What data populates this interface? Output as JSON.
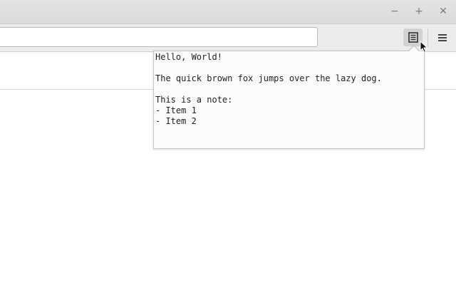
{
  "window": {
    "minimize_icon": "minimize-icon",
    "maximize_icon": "maximize-icon",
    "close_icon": "close-icon",
    "minimize_glyph": "−",
    "maximize_glyph": "+",
    "close_glyph": "✕"
  },
  "toolbar": {
    "url_value": "",
    "url_placeholder": "",
    "notes_button_icon": "notes-icon",
    "menu_icon": "hamburger-menu-icon"
  },
  "popup": {
    "note_content": "Hello, World!\n\nThe quick brown fox jumps over the lazy dog.\n\nThis is a note:\n- Item 1\n- Item 2"
  },
  "colors": {
    "titlebar": "#dadada",
    "toolbar": "#ececec",
    "active_button": "#d2d2d2",
    "popup_background": "#fbfbfb"
  }
}
